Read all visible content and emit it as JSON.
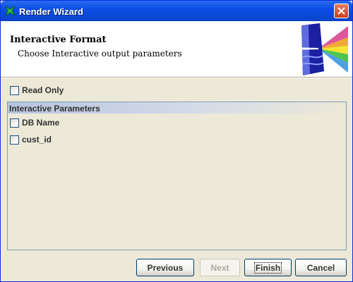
{
  "window": {
    "title": "Render Wizard"
  },
  "header": {
    "title": "Interactive Format",
    "subtitle": "Choose Interactive output parameters"
  },
  "options": {
    "read_only_label": "Read Only",
    "read_only_checked": false
  },
  "parameters": {
    "heading": "Interactive Parameters",
    "items": [
      {
        "label": "DB Name",
        "checked": false
      },
      {
        "label": "cust_id",
        "checked": false
      }
    ]
  },
  "buttons": {
    "previous": "Previous",
    "next": "Next",
    "finish": "Finish",
    "cancel": "Cancel"
  },
  "colors": {
    "titlebar": "#0c4ee2",
    "dialog_bg": "#ece9d8",
    "header_bg": "#ffffff",
    "close_button": "#c8411d"
  }
}
